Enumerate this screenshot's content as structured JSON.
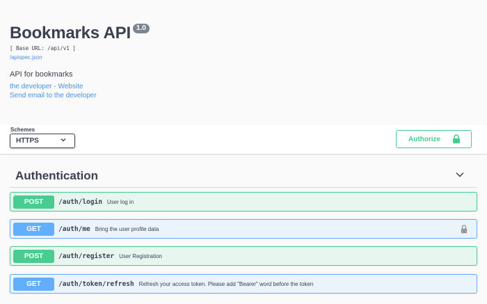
{
  "info": {
    "title": "Bookmarks API",
    "version": "1.0",
    "base_url": "[ Base URL: /api/v1 ]",
    "spec_link": "/apispec.json",
    "description": "API for bookmarks",
    "developer_link": "the developer - Website",
    "email_link": "Send email to the developer"
  },
  "schemes": {
    "label": "Schemes",
    "selected": "HTTPS"
  },
  "authorize": {
    "label": "Authorize"
  },
  "tag": {
    "name": "Authentication"
  },
  "operations": [
    {
      "method": "POST",
      "path": "/auth/login",
      "summary": "User log in",
      "locked": false
    },
    {
      "method": "GET",
      "path": "/auth/me",
      "summary": "Bring the user profile data",
      "locked": true
    },
    {
      "method": "POST",
      "path": "/auth/register",
      "summary": "User Registration",
      "locked": false
    },
    {
      "method": "GET",
      "path": "/auth/token/refresh",
      "summary": "Refresh your access token. Please add \"Bearer\" word before the token",
      "locked": false
    }
  ],
  "colors": {
    "post": "#49cc90",
    "get": "#61afe0",
    "link": "#4990e2",
    "text": "#3b4151"
  },
  "icons": {
    "schemes_dropdown": "chevron-down-icon",
    "authorize_lock": "lock-icon",
    "tag_toggle": "chevron-down-icon",
    "operation_lock": "lock-icon"
  }
}
